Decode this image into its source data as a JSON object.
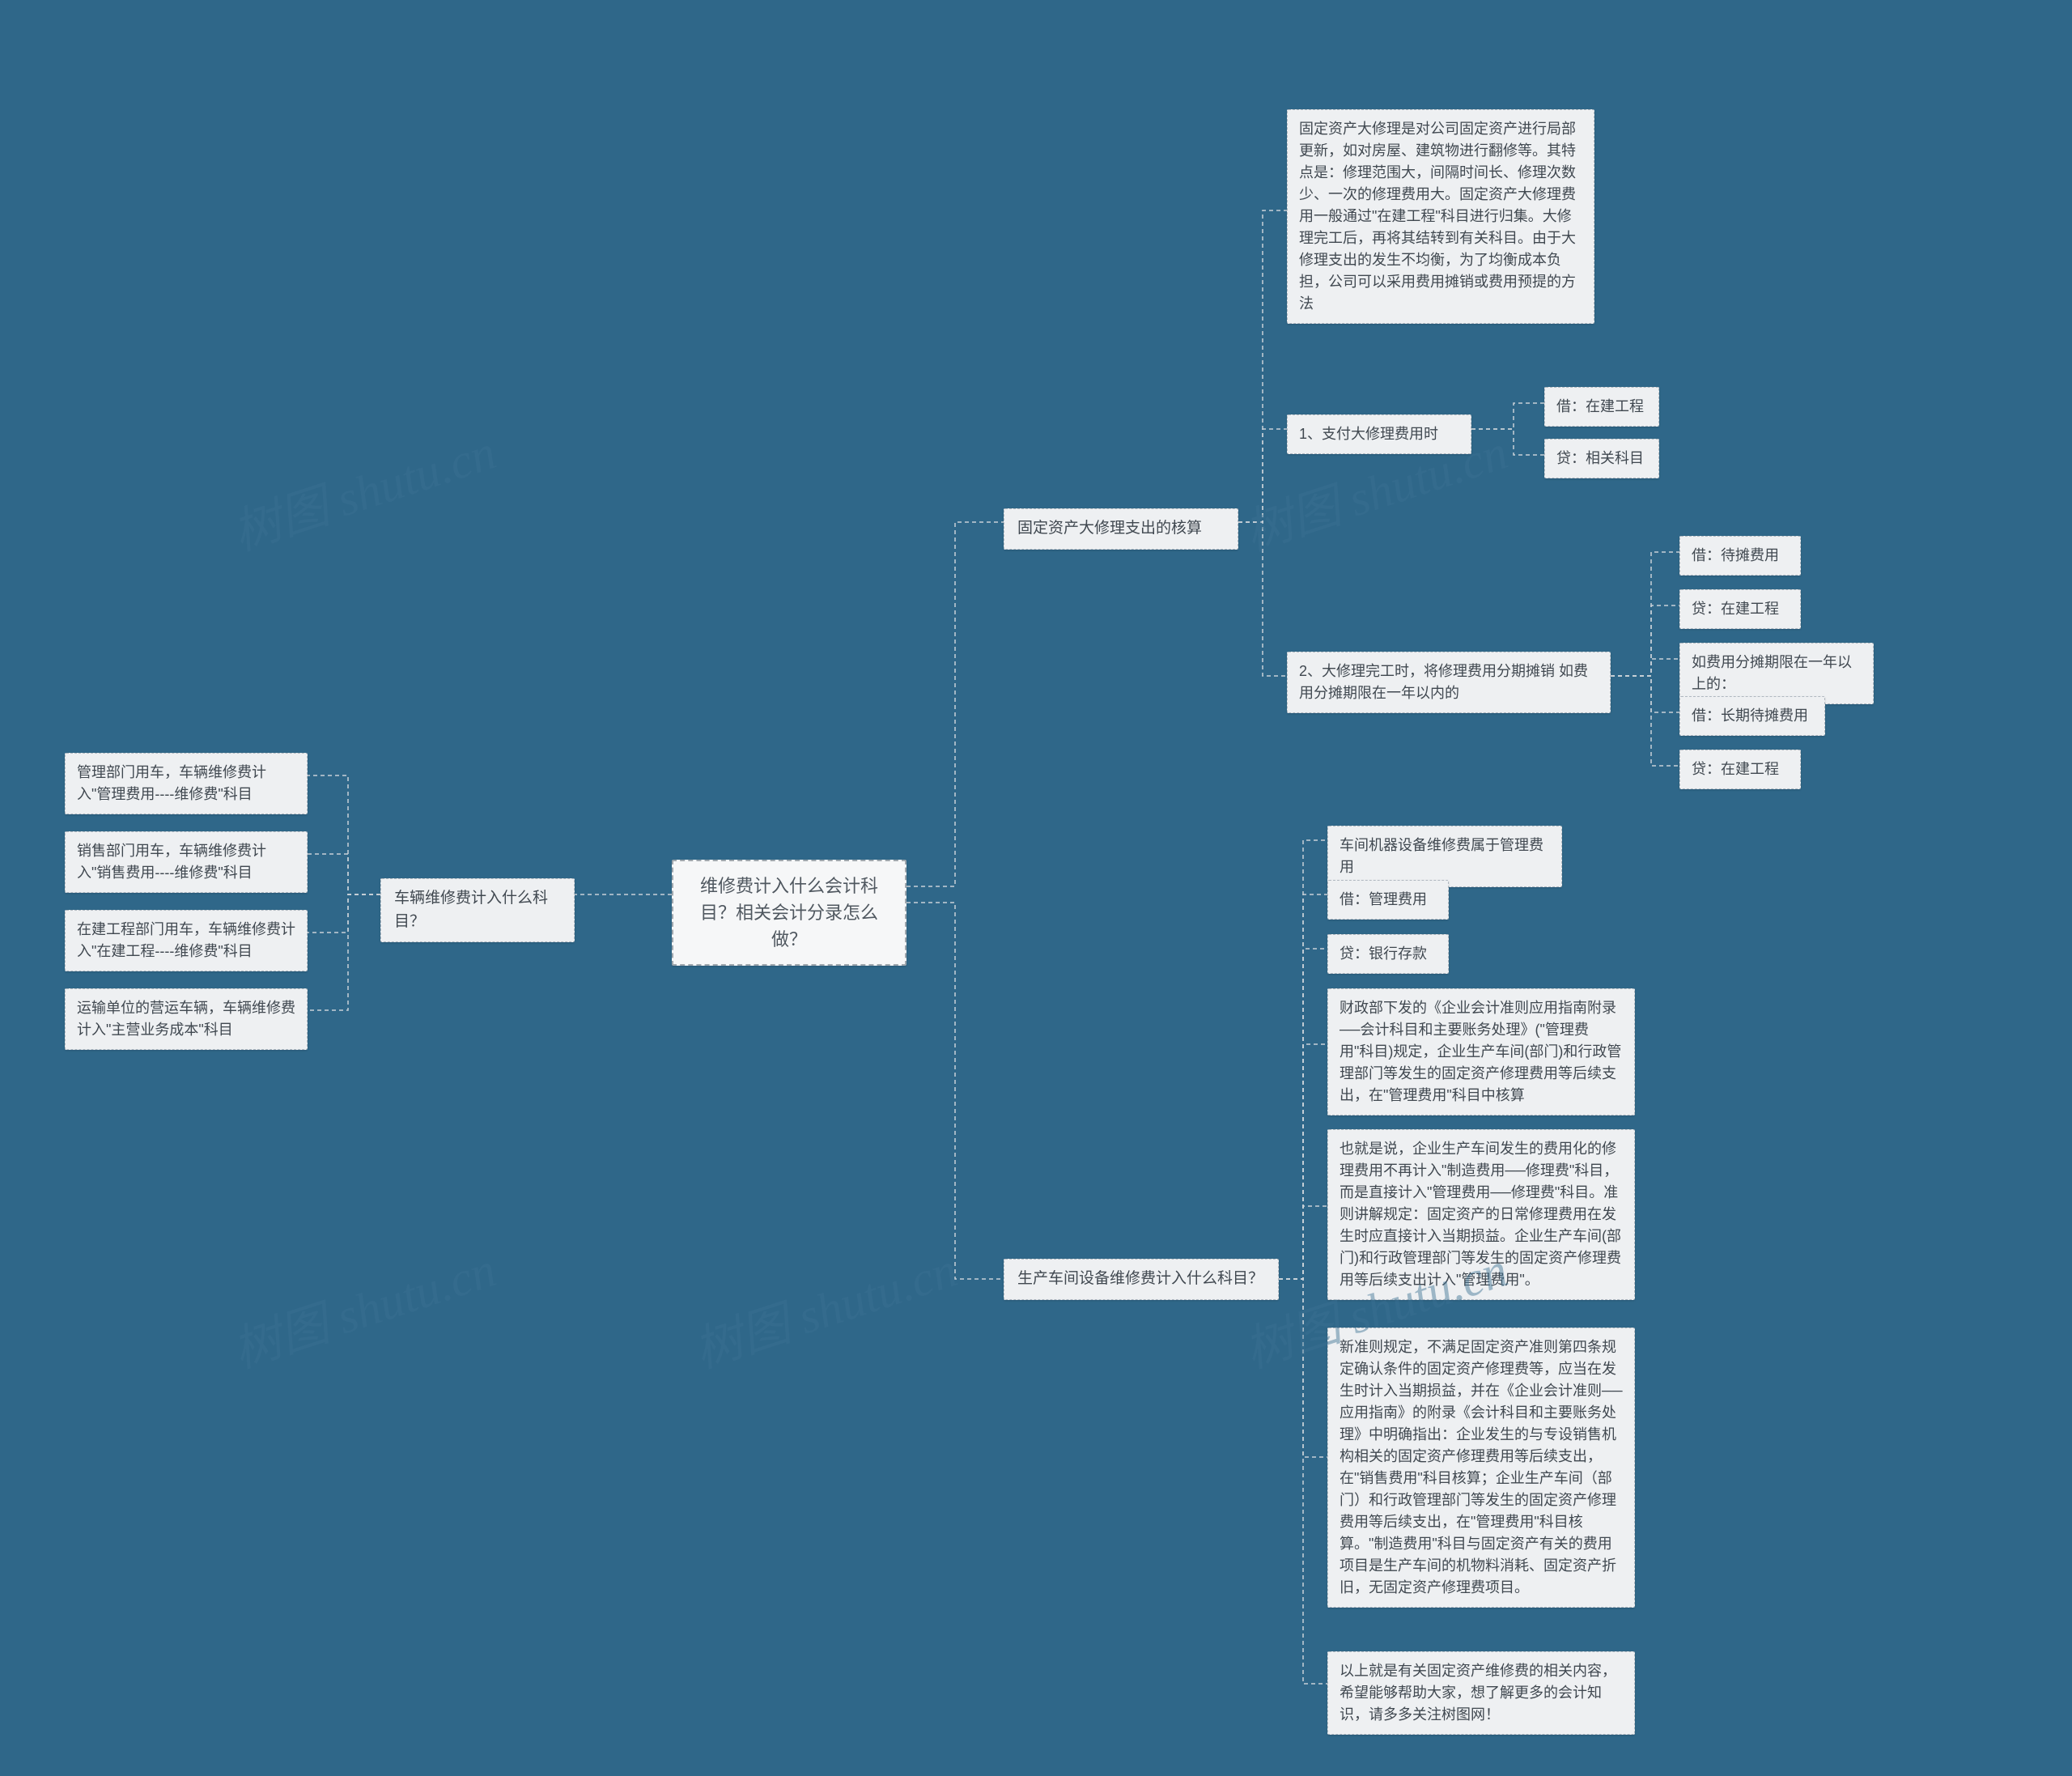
{
  "root": "维修费计入什么会计科目？相关会计分录怎么做？",
  "left": {
    "branch1": {
      "label": "车辆维修费计入什么科目？",
      "children": [
        "管理部门用车，车辆维修费计入\"管理费用----维修费\"科目",
        "销售部门用车，车辆维修费计入\"销售费用----维修费\"科目",
        "在建工程部门用车，车辆维修费计入\"在建工程----维修费\"科目",
        "运输单位的营运车辆，车辆维修费计入\"主营业务成本\"科目"
      ]
    }
  },
  "right": {
    "branch1": {
      "label": "固定资产大修理支出的核算",
      "children": {
        "c0": "固定资产大修理是对公司固定资产进行局部更新，如对房屋、建筑物进行翻修等。其特点是：修理范围大，间隔时间长、修理次数少、一次的修理费用大。固定资产大修理费用一般通过\"在建工程\"科目进行归集。大修理完工后，再将其结转到有关科目。由于大修理支出的发生不均衡，为了均衡成本负担，公司可以采用费用摊销或费用预提的方法",
        "c1": {
          "label": "1、支付大修理费用时",
          "children": [
            "借：在建工程",
            "贷：相关科目"
          ]
        },
        "c2": {
          "label": "2、大修理完工时，将修理费用分期摊销 如费用分摊期限在一年以内的",
          "children": [
            "借：待摊费用",
            "贷：在建工程",
            "如费用分摊期限在一年以上的：",
            "借：长期待摊费用",
            "贷：在建工程"
          ]
        }
      }
    },
    "branch2": {
      "label": "生产车间设备维修费计入什么科目？",
      "children": [
        "车间机器设备维修费属于管理费用",
        "借：管理费用",
        "贷：银行存款",
        "财政部下发的《企业会计准则应用指南附录──会计科目和主要账务处理》(\"管理费用\"科目)规定，企业生产车间(部门)和行政管理部门等发生的固定资产修理费用等后续支出，在\"管理费用\"科目中核算",
        "也就是说，企业生产车间发生的费用化的修理费用不再计入\"制造费用──修理费\"科目，而是直接计入\"管理费用──修理费\"科目。准则讲解规定：固定资产的日常修理费用在发生时应直接计入当期损益。企业生产车间(部门)和行政管理部门等发生的固定资产修理费用等后续支出计入\"管理费用\"。",
        "新准则规定，不满足固定资产准则第四条规定确认条件的固定资产修理费等，应当在发生时计入当期损益，并在《企业会计准则──应用指南》的附录《会计科目和主要账务处理》中明确指出：企业发生的与专设销售机构相关的固定资产修理费用等后续支出，在\"销售费用\"科目核算；企业生产车间（部门）和行政管理部门等发生的固定资产修理费用等后续支出，在\"管理费用\"科目核算。\"制造费用\"科目与固定资产有关的费用项目是生产车间的机物料消耗、固定资产折旧，无固定资产修理费项目。",
        "以上就是有关固定资产维修费的相关内容，希望能够帮助大家，想了解更多的会计知识，请多多关注树图网！"
      ]
    }
  },
  "watermarks": [
    "树图 shutu.cn",
    "树图 shutu.cn",
    "树图 shutu.cn",
    "树图 shutu.cn",
    "树图 shutu.cn"
  ]
}
